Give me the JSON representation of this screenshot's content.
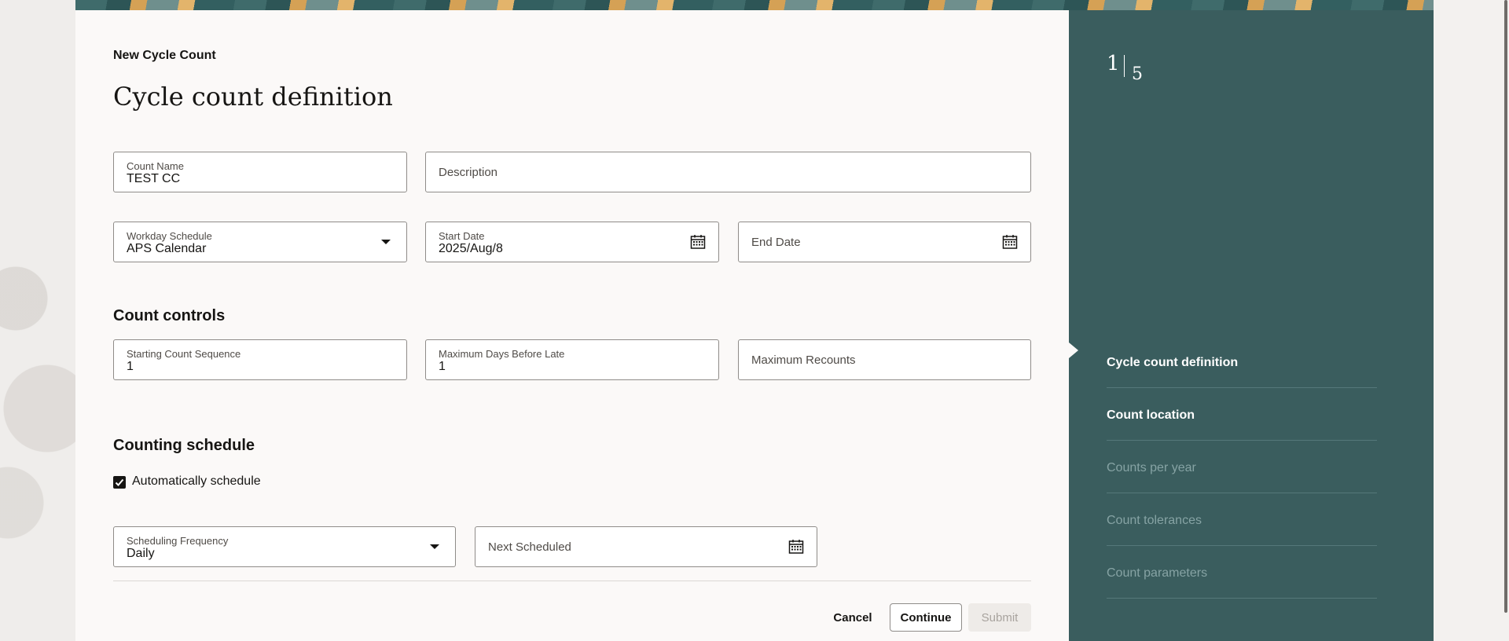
{
  "page": {
    "eyebrow": "New Cycle Count",
    "title": "Cycle count definition"
  },
  "fields": {
    "count_name": {
      "label": "Count Name",
      "value": "TEST CC"
    },
    "description": {
      "placeholder": "Description"
    },
    "workday_schedule": {
      "label": "Workday Schedule",
      "value": "APS Calendar"
    },
    "start_date": {
      "label": "Start Date",
      "value": "2025/Aug/8"
    },
    "end_date": {
      "placeholder": "End Date"
    },
    "starting_count_sequence": {
      "label": "Starting Count Sequence",
      "value": "1"
    },
    "max_days_before_late": {
      "label": "Maximum Days Before Late",
      "value": "1"
    },
    "max_recounts": {
      "placeholder": "Maximum Recounts"
    },
    "scheduling_frequency": {
      "label": "Scheduling Frequency",
      "value": "Daily"
    },
    "next_scheduled": {
      "placeholder": "Next Scheduled"
    }
  },
  "sections": {
    "count_controls": "Count controls",
    "counting_schedule": "Counting schedule"
  },
  "auto_schedule": {
    "label": "Automatically schedule",
    "checked": true
  },
  "buttons": {
    "cancel": "Cancel",
    "continue": "Continue",
    "submit": "Submit"
  },
  "progress": {
    "current": "1",
    "total": "5",
    "steps": [
      {
        "label": "Cycle count definition",
        "state": "active"
      },
      {
        "label": "Count location",
        "state": "done"
      },
      {
        "label": "Counts per year",
        "state": "pending"
      },
      {
        "label": "Count tolerances",
        "state": "pending"
      },
      {
        "label": "Count parameters",
        "state": "pending"
      }
    ]
  },
  "colors": {
    "panel": "#3a5d5e",
    "pending_step": "#86a3a4"
  }
}
